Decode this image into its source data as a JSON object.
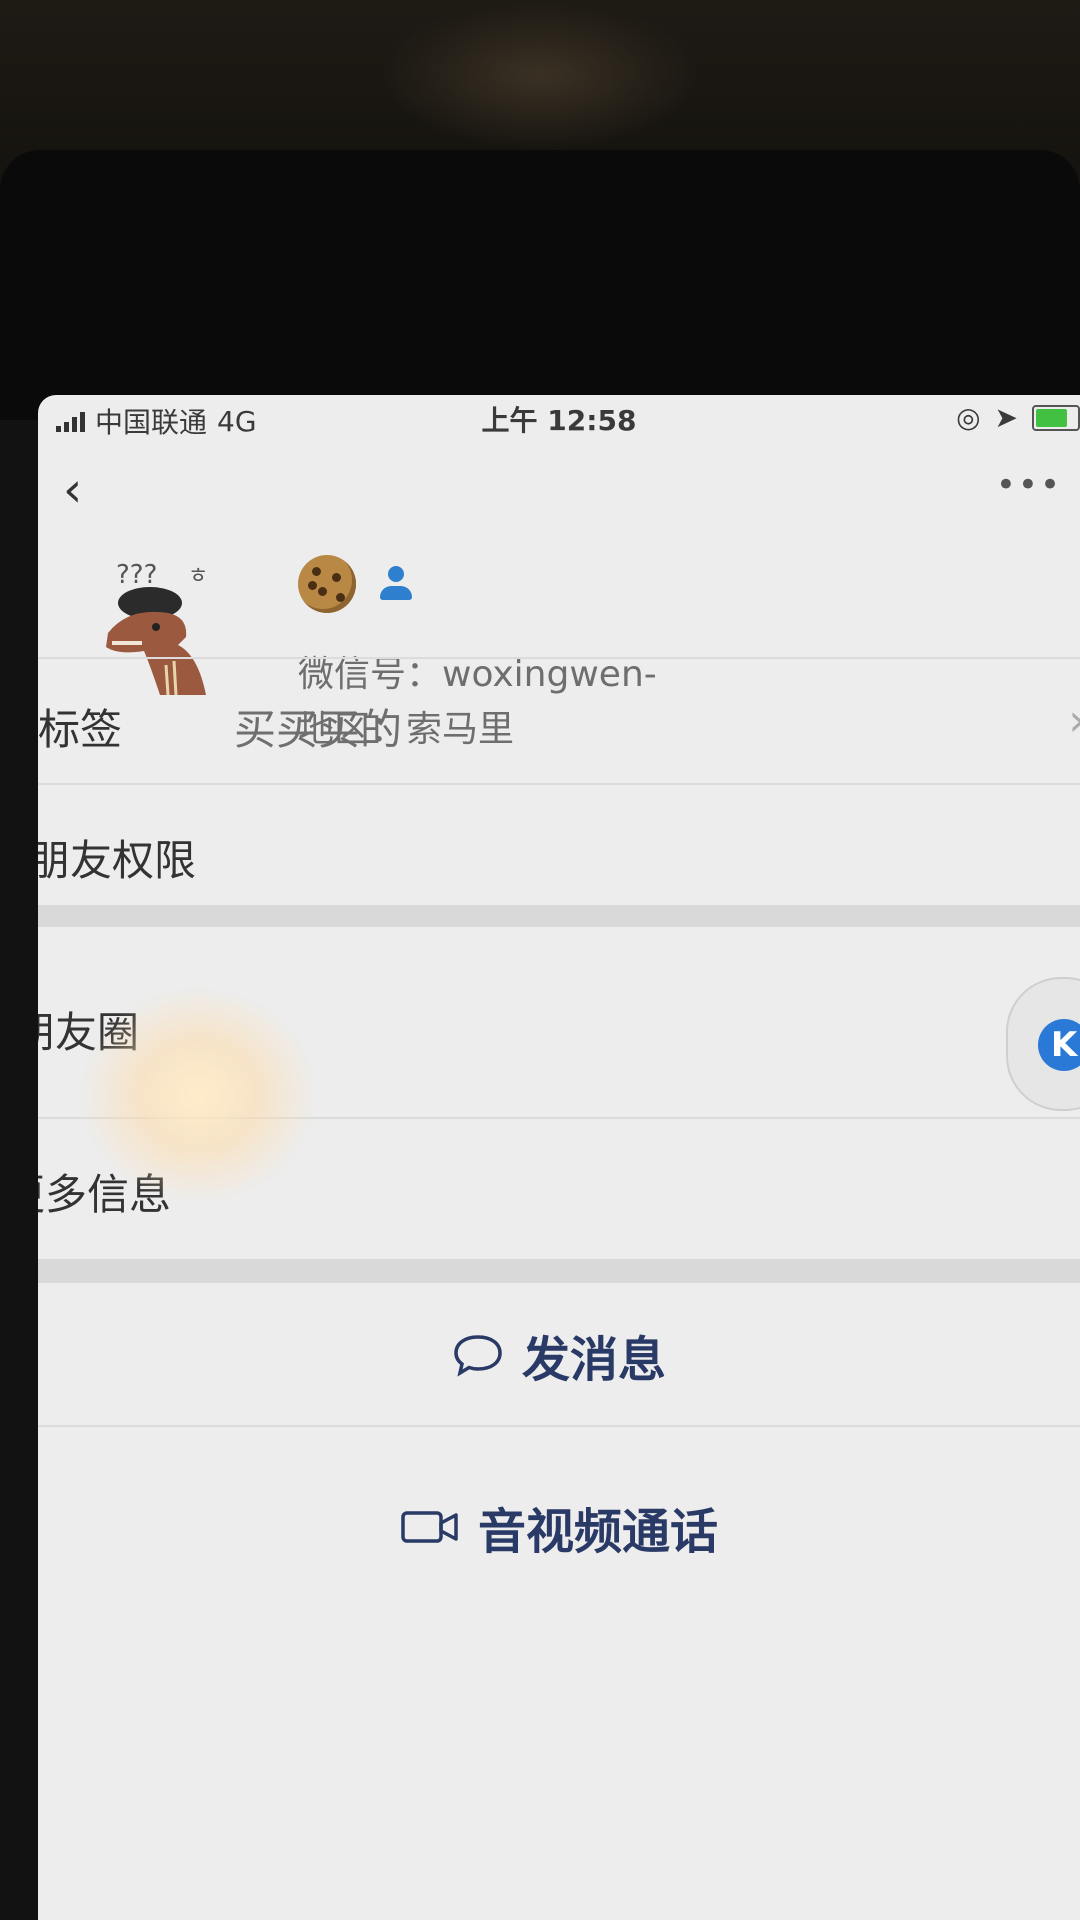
{
  "status_bar": {
    "carrier": "中国联通",
    "network": "4G",
    "time": "上午 12:58"
  },
  "nav": {
    "back_icon": "chevron-left-icon",
    "more_icon": "more-dots-icon"
  },
  "profile": {
    "avatar_text": "??? ",
    "nickname_emoji": "cookie",
    "contact_icon": "contact-person-icon",
    "wechat_id_label": "微信号：",
    "wechat_id": "woxingwen-",
    "region_label": "地区：",
    "region": "索马里"
  },
  "rows": {
    "tags": {
      "label": "标签",
      "value": "买买买的"
    },
    "permissions": {
      "label": "朋友权限"
    },
    "moments": {
      "label": "朋友圈"
    },
    "more_info": {
      "label": "更多信息"
    }
  },
  "actions": {
    "message": {
      "label": "发消息",
      "icon": "chat-bubble-icon"
    },
    "call": {
      "label": "音视频通话",
      "icon": "video-camera-icon"
    }
  },
  "colors": {
    "accent_blue": "#2f7fcf",
    "action_text": "#2a3a66",
    "battery_green": "#41c042"
  }
}
